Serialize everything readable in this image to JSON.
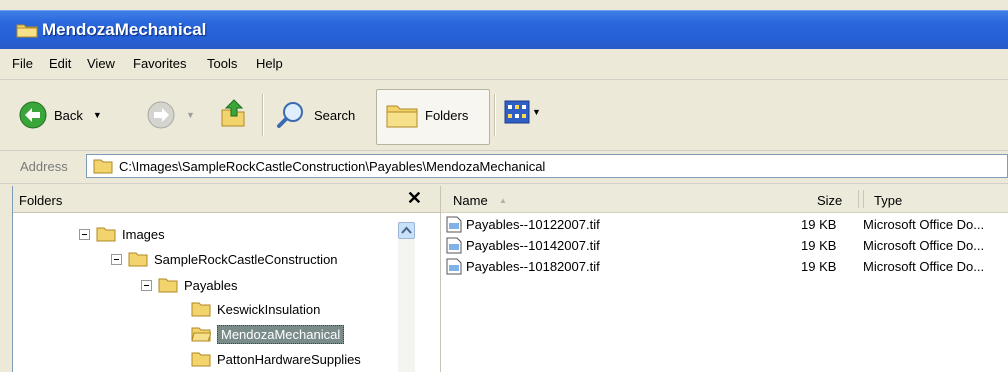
{
  "window": {
    "title": "MendozaMechanical"
  },
  "menu": [
    "File",
    "Edit",
    "View",
    "Favorites",
    "Tools",
    "Help"
  ],
  "toolbar": {
    "back_label": "Back",
    "search_label": "Search",
    "folders_label": "Folders"
  },
  "address": {
    "label": "Address",
    "path": "C:\\Images\\SampleRockCastleConstruction\\Payables\\MendozaMechanical"
  },
  "folders_pane": {
    "title": "Folders",
    "close_glyph": "✕",
    "tree": [
      {
        "label": "Images",
        "expanded": true
      },
      {
        "label": "SampleRockCastleConstruction",
        "expanded": true
      },
      {
        "label": "Payables",
        "expanded": true
      },
      {
        "label": "KeswickInsulation"
      },
      {
        "label": "MendozaMechanical",
        "selected": true
      },
      {
        "label": "PattonHardwareSupplies"
      }
    ]
  },
  "file_list": {
    "columns": {
      "name": "Name",
      "size": "Size",
      "type": "Type"
    },
    "sort_indicator": "▲",
    "rows": [
      {
        "name": "Payables--10122007.tif",
        "size": "19 KB",
        "type": "Microsoft Office Do..."
      },
      {
        "name": "Payables--10142007.tif",
        "size": "19 KB",
        "type": "Microsoft Office Do..."
      },
      {
        "name": "Payables--10182007.tif",
        "size": "19 KB",
        "type": "Microsoft Office Do..."
      }
    ]
  },
  "colors": {
    "titlebar": "#2b68dc",
    "selection": "#7a8c8a",
    "chrome": "#ece9d8"
  }
}
